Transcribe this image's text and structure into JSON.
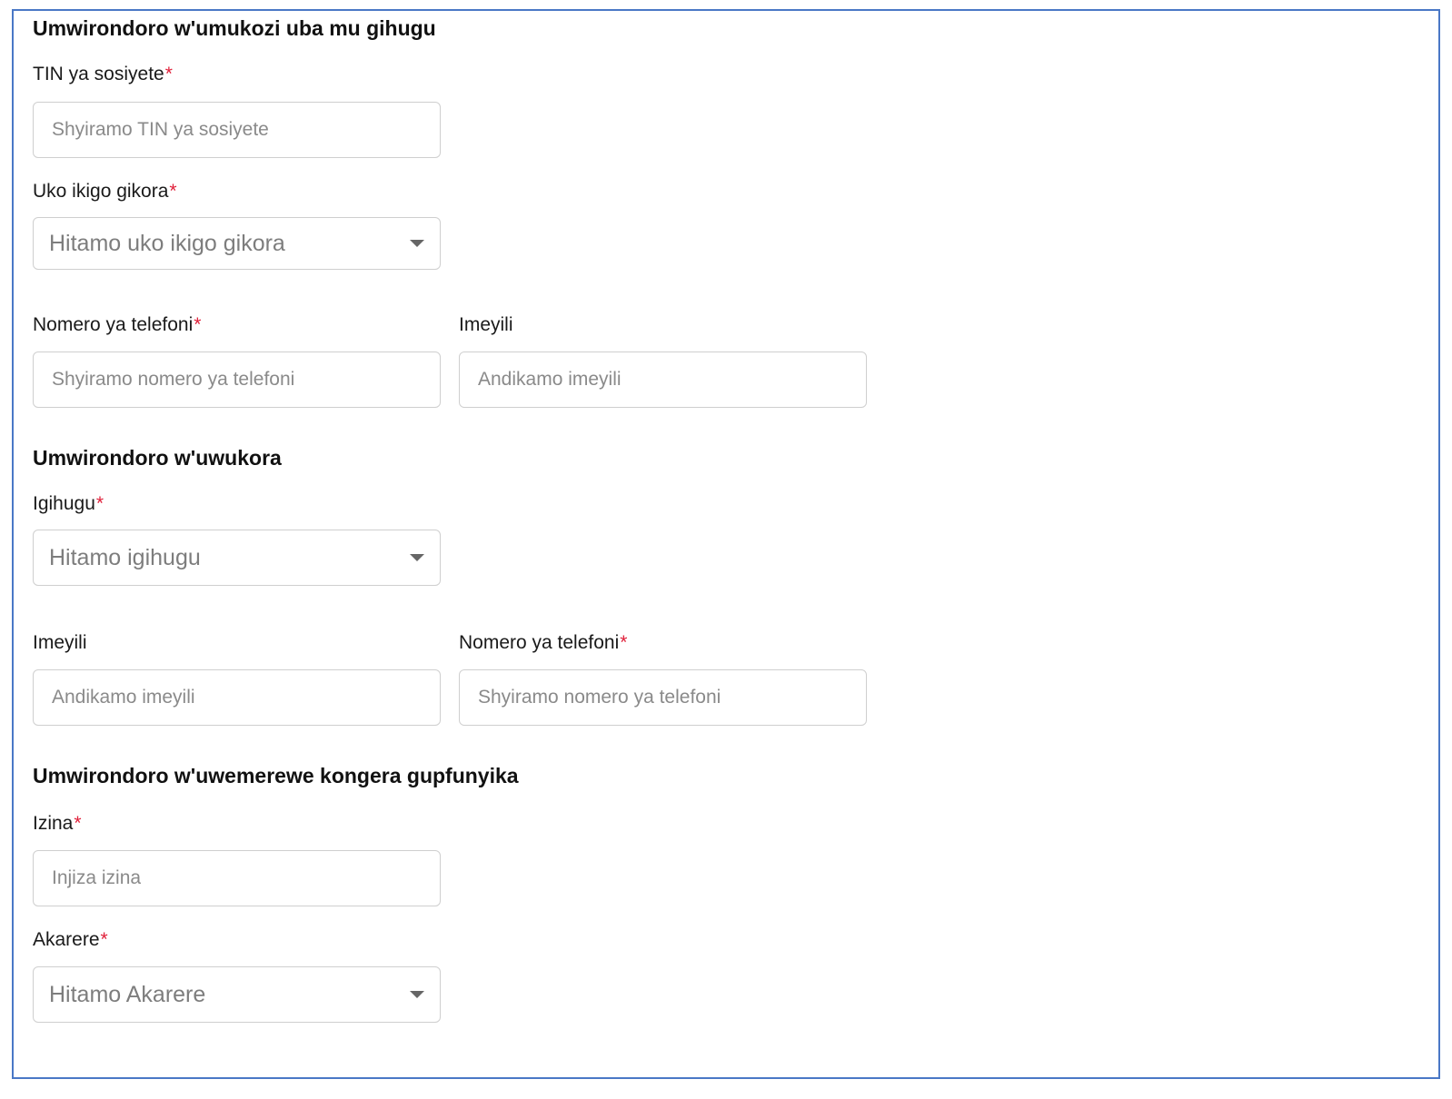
{
  "sections": {
    "company": {
      "title": "Umwirondoro w'umukozi uba mu gihugu",
      "tin_label": "TIN ya sosiyete",
      "tin_placeholder": "Shyiramo TIN ya sosiyete",
      "location_label": "Uko ikigo gikora",
      "location_placeholder": "Hitamo uko ikigo gikora",
      "phone_label": "Nomero ya telefoni",
      "phone_placeholder": "Shyiramo nomero ya telefoni",
      "email_label": "Imeyili",
      "email_placeholder": "Andikamo imeyili"
    },
    "worker": {
      "title": "Umwirondoro w'uwukora",
      "country_label": "Igihugu",
      "country_placeholder": "Hitamo igihugu",
      "email_label": "Imeyili",
      "email_placeholder": "Andikamo imeyili",
      "phone_label": "Nomero ya telefoni",
      "phone_placeholder": "Shyiramo nomero ya telefoni"
    },
    "approver": {
      "title": "Umwirondoro w'uwemerewe kongera gupfunyika",
      "name_label": "Izina",
      "name_placeholder": "Injiza izina",
      "district_label": "Akarere",
      "district_placeholder": "Hitamo Akarere"
    }
  },
  "required_marker": "*",
  "colors": {
    "frame_border": "#4a78c6",
    "required": "#e0203a",
    "input_border": "#cfcfcf",
    "placeholder": "#8a8a8a"
  },
  "icons": {
    "dropdown": "caret-down-icon"
  }
}
